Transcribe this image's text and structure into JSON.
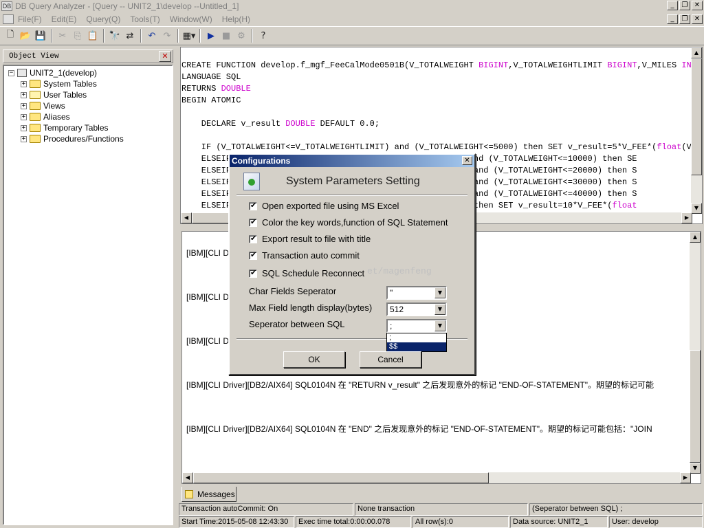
{
  "window": {
    "title": "DB Query Analyzer - [Query -- UNIT2_1\\develop --Untitled_1]",
    "app_icon": "DB"
  },
  "menu": {
    "items": [
      "File(F)",
      "Edit(E)",
      "Query(Q)",
      "Tools(T)",
      "Window(W)",
      "Help(H)"
    ]
  },
  "object_view": {
    "header": "Object View",
    "root": "UNIT2_1(develop)",
    "children": [
      "System Tables",
      "User Tables",
      "Views",
      "Aliases",
      "Temporary Tables",
      "Procedures/Functions"
    ]
  },
  "editor": {
    "lines": [
      [
        {
          "t": "CREATE FUNCTION develop.f_mgf_FeeCalMode0501B(V_TOTALWEIGHT "
        },
        {
          "t": "BIGINT",
          "k": 1
        },
        {
          "t": ",V_TOTALWEIGHTLIMIT "
        },
        {
          "t": "BIGINT",
          "k": 1
        },
        {
          "t": ",V_MILES "
        },
        {
          "t": "INTEG",
          "k": 1
        }
      ],
      [
        {
          "t": "LANGUAGE SQL"
        }
      ],
      [
        {
          "t": "RETURNS "
        },
        {
          "t": "DOUBLE",
          "k": 1
        }
      ],
      [
        {
          "t": "BEGIN ATOMIC"
        }
      ],
      [
        {
          "t": ""
        }
      ],
      [
        {
          "t": "    DECLARE v_result "
        },
        {
          "t": "DOUBLE",
          "k": 1
        },
        {
          "t": " DEFAULT 0.0;"
        }
      ],
      [
        {
          "t": ""
        }
      ],
      [
        {
          "t": "    IF (V_TOTALWEIGHT<=V_TOTALWEIGHTLIMIT) and (V_TOTALWEIGHT<=5000) then SET v_result=5*V_FEE*("
        },
        {
          "t": "float",
          "k": 1
        },
        {
          "t": "(V_MI"
        }
      ],
      [
        {
          "t": "    ELSEIF                                      GHT>5000) and (V_TOTALWEIGHT<=10000) then SE"
        }
      ],
      [
        {
          "t": "    ELSEIF                                      GHT>10000) and (V_TOTALWEIGHT<=20000) then S"
        }
      ],
      [
        {
          "t": "    ELSEIF                                      GHT>20000) and (V_TOTALWEIGHT<=30000) then S"
        }
      ],
      [
        {
          "t": "    ELSEIF                                      GHT>30000) and (V_TOTALWEIGHT<=40000) then S"
        }
      ],
      [
        {
          "t": "    ELSEIF                                      GHT>40000) then SET v_result=10*V_FEE*("
        },
        {
          "t": "float",
          "k": 1
        }
      ]
    ]
  },
  "messages": {
    "lines": [
      "[IBM][CLI D                                                       之后发现意外的标记 \"ELSEIF (V_TOTALWEIGHT<=V_",
      "[IBM][CLI D                                                       之后发现意外的标记 \"ELSEIF (V_TOTALWEIGHT<=V_",
      "[IBM][CLI D                                                          \"END-OF-STATEMENT\"。期望的标记可能包括：\"JOI",
      "[IBM][CLI Driver][DB2/AIX64] SQL0104N  在 \"RETURN v_result\" 之后发现意外的标记 \"END-OF-STATEMENT\"。期望的标记可能",
      "[IBM][CLI Driver][DB2/AIX64] SQL0104N  在 \"END\" 之后发现意外的标记 \"END-OF-STATEMENT\"。期望的标记可能包括：\"JOIN"
    ],
    "tab": "Messages"
  },
  "status": {
    "autocommit": "Transaction autoCommit: On",
    "transaction": "None transaction",
    "separator": "(Seperator between SQL)   ;",
    "start_time": "Start Time:2015-05-08 12:43:30",
    "exec_time": "Exec time total:0:00:00.078",
    "rows": "All row(s):0",
    "datasource": "Data source: UNIT2_1",
    "user": "User: develop"
  },
  "dialog": {
    "title": "Configurations",
    "heading": "System Parameters Setting",
    "checkboxes": [
      "Open exported file using MS Excel",
      "Color the key words,function of SQL Statement",
      "Export result to file with title",
      "Transaction auto commit",
      "SQL Schedule Reconnect"
    ],
    "fields": {
      "char_sep_label": "Char Fields Seperator",
      "char_sep_value": "\"",
      "max_len_label": "Max Field length display(bytes)",
      "max_len_value": "512",
      "sql_sep_label": "Seperator between SQL",
      "sql_sep_value": ";"
    },
    "dropdown_options": [
      ";",
      "$$"
    ],
    "ok_label": "OK",
    "cancel_label": "Cancel",
    "watermark": "et/magenfeng"
  }
}
